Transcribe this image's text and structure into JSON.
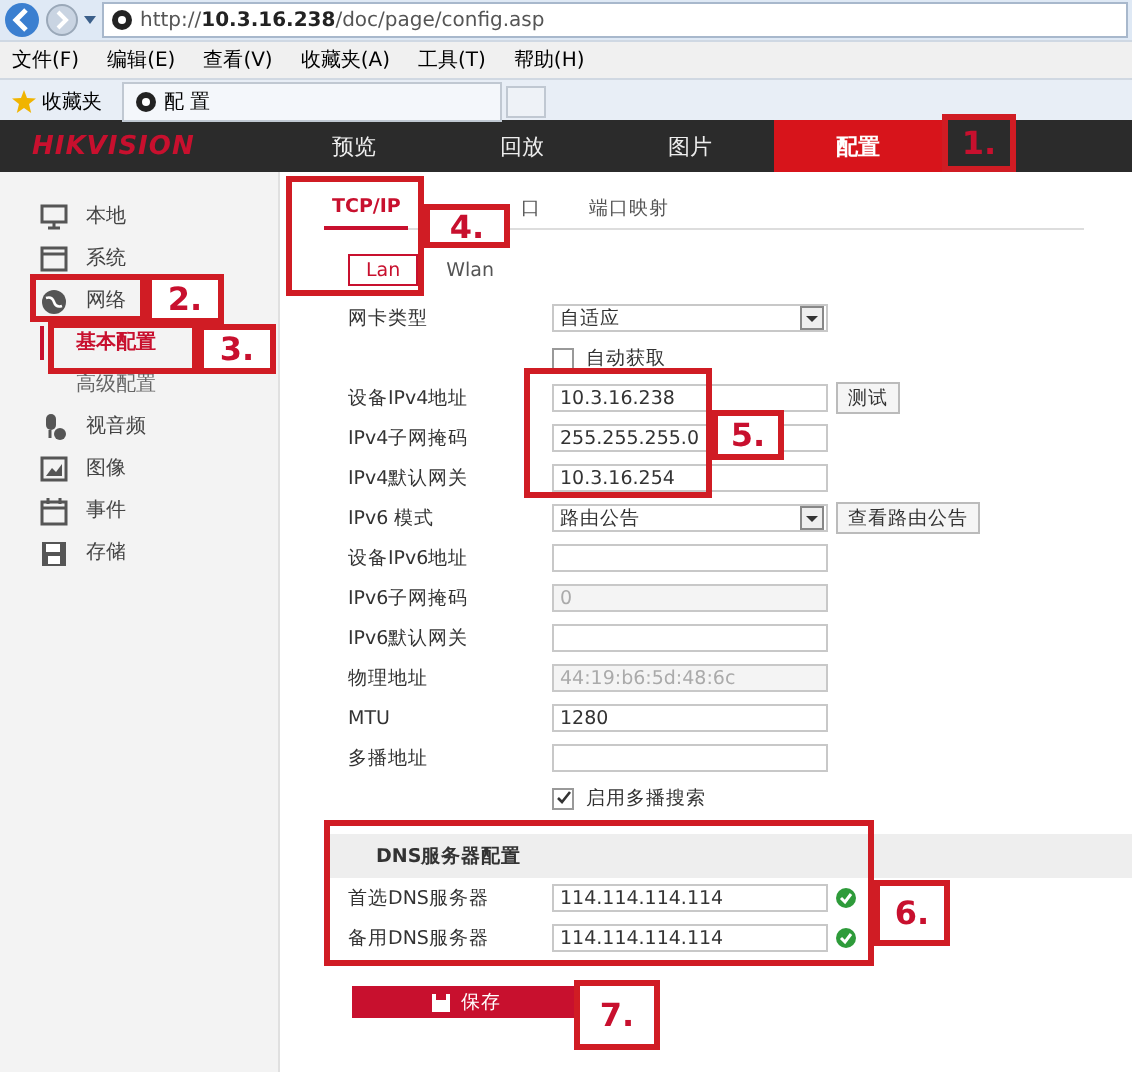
{
  "browser": {
    "url": "http://**10.3.16.238**/doc/page/config.asp",
    "menu": [
      "文件(F)",
      "编辑(E)",
      "查看(V)",
      "收藏夹(A)",
      "工具(T)",
      "帮助(H)"
    ],
    "favorites": "收藏夹",
    "tab_title": "配 置"
  },
  "header": {
    "logo": "HIKVISION",
    "nav": [
      {
        "label": "预览",
        "selected": false
      },
      {
        "label": "回放",
        "selected": false
      },
      {
        "label": "图片",
        "selected": false
      },
      {
        "label": "配置",
        "selected": true
      }
    ]
  },
  "sidebar": {
    "items": [
      {
        "label": "本地",
        "selected": false
      },
      {
        "label": "系统",
        "selected": false
      },
      {
        "label": "网络",
        "selected": false,
        "children": [
          {
            "label": "基本配置",
            "selected": true
          },
          {
            "label": "高级配置",
            "selected": false
          }
        ]
      },
      {
        "label": "视音频",
        "selected": false
      },
      {
        "label": "图像",
        "selected": false
      },
      {
        "label": "事件",
        "selected": false
      },
      {
        "label": "存储",
        "selected": false
      }
    ]
  },
  "tabs": [
    {
      "label": "TCP/IP",
      "selected": true
    },
    {
      "label": "口",
      "selected": false
    },
    {
      "label": "端口映射",
      "selected": false
    }
  ],
  "subtabs": [
    {
      "label": "Lan",
      "selected": true
    },
    {
      "label": "Wlan",
      "selected": false
    }
  ],
  "form": [
    {
      "kind": "select",
      "label": "网卡类型",
      "value": "自适应"
    },
    {
      "kind": "checkbox",
      "label": "自动获取",
      "checked": false
    },
    {
      "kind": "input",
      "label": "设备IPv4地址",
      "value": "10.3.16.238",
      "disabled": false,
      "button": "测试"
    },
    {
      "kind": "input",
      "label": "IPv4子网掩码",
      "value": "255.255.255.0",
      "disabled": false
    },
    {
      "kind": "input",
      "label": "IPv4默认网关",
      "value": "10.3.16.254",
      "disabled": false
    },
    {
      "kind": "select",
      "label": "IPv6 模式",
      "value": "路由公告",
      "button": "查看路由公告"
    },
    {
      "kind": "input",
      "label": "设备IPv6地址"
    },
    {
      "kind": "input",
      "label": "IPv6子网掩码",
      "value": "0",
      "disabled": true
    },
    {
      "kind": "input",
      "label": "IPv6默认网关"
    },
    {
      "kind": "input",
      "label": "物理地址",
      "value": "44:19:b6:5d:48:6c",
      "disabled": true
    },
    {
      "kind": "input",
      "label": "MTU",
      "value": "1280",
      "disabled": false
    },
    {
      "kind": "input",
      "label": "多播地址"
    },
    {
      "kind": "checkbox",
      "label": "启用多播搜索",
      "checked": true
    }
  ],
  "dns": {
    "title": "DNS服务器配置",
    "rows": [
      {
        "label": "首选DNS服务器",
        "value": "114.114.114.114",
        "valid": true
      },
      {
        "label": "备用DNS服务器",
        "value": "114.114.114.114",
        "valid": true
      }
    ]
  },
  "save_button": "保存",
  "annotations": [
    "1.",
    "2.",
    "3.",
    "4.",
    "5.",
    "6.",
    "7."
  ]
}
